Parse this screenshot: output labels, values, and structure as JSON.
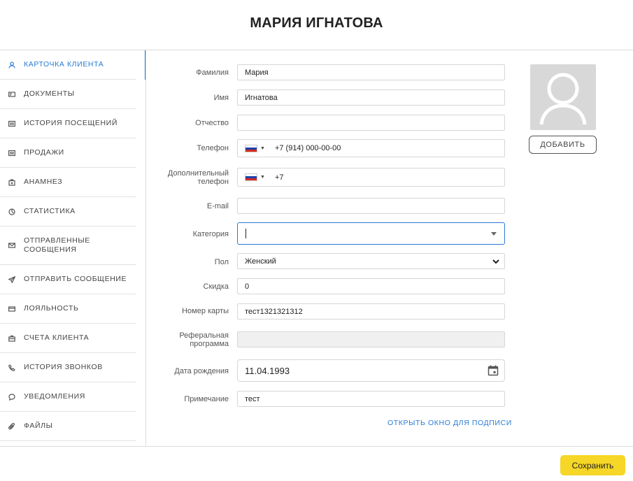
{
  "title": "МАРИЯ ИГНАТОВА",
  "sidebar": {
    "items": [
      {
        "label": "КАРТОЧКА КЛИЕНТА",
        "icon": "person-icon",
        "active": true
      },
      {
        "label": "ДОКУМЕНТЫ",
        "icon": "id-card-icon"
      },
      {
        "label": "ИСТОРИЯ ПОСЕЩЕНИЙ",
        "icon": "list-icon"
      },
      {
        "label": "ПРОДАЖИ",
        "icon": "list-icon"
      },
      {
        "label": "АНАМНЕЗ",
        "icon": "medical-kit-icon"
      },
      {
        "label": "СТАТИСТИКА",
        "icon": "clock-chart-icon"
      },
      {
        "label": "ОТПРАВЛЕННЫЕ СООБЩЕНИЯ",
        "icon": "envelope-icon"
      },
      {
        "label": "ОТПРАВИТЬ СООБЩЕНИЕ",
        "icon": "paper-plane-icon"
      },
      {
        "label": "ЛОЯЛЬНОСТЬ",
        "icon": "card-icon"
      },
      {
        "label": "СЧЕТА КЛИЕНТА",
        "icon": "briefcase-icon"
      },
      {
        "label": "ИСТОРИЯ ЗВОНКОВ",
        "icon": "phone-icon"
      },
      {
        "label": "УВЕДОМЛЕНИЯ",
        "icon": "chat-bubble-icon"
      },
      {
        "label": "ФАЙЛЫ",
        "icon": "paperclip-icon"
      }
    ]
  },
  "form": {
    "last_name": {
      "label": "Фамилия",
      "value": "Мария"
    },
    "first_name": {
      "label": "Имя",
      "value": "Игнатова"
    },
    "middle_name": {
      "label": "Отчество",
      "value": ""
    },
    "phone": {
      "label": "Телефон",
      "value": "+7 (914) 000-00-00"
    },
    "extra_phone": {
      "label": "Дополнительный телефон",
      "value": "+7"
    },
    "email": {
      "label": "E-mail",
      "value": ""
    },
    "category": {
      "label": "Категория",
      "value": ""
    },
    "gender": {
      "label": "Пол",
      "value": "Женский"
    },
    "discount": {
      "label": "Скидка",
      "value": "0"
    },
    "card_number": {
      "label": "Номер карты",
      "value": "тест1321321312"
    },
    "referral": {
      "label": "Реферальная программа",
      "value": ""
    },
    "birth_date": {
      "label": "Дата рождения",
      "value": "11.04.1993"
    },
    "note": {
      "label": "Примечание",
      "value": "тест"
    }
  },
  "avatar": {
    "add_label": "ДОБАВИТЬ"
  },
  "sign_link": "ОТКРЫТЬ ОКНО ДЛЯ ПОДПИСИ",
  "save_label": "Сохранить",
  "colors": {
    "accent": "#2a7bd3",
    "save": "#f6d626"
  }
}
